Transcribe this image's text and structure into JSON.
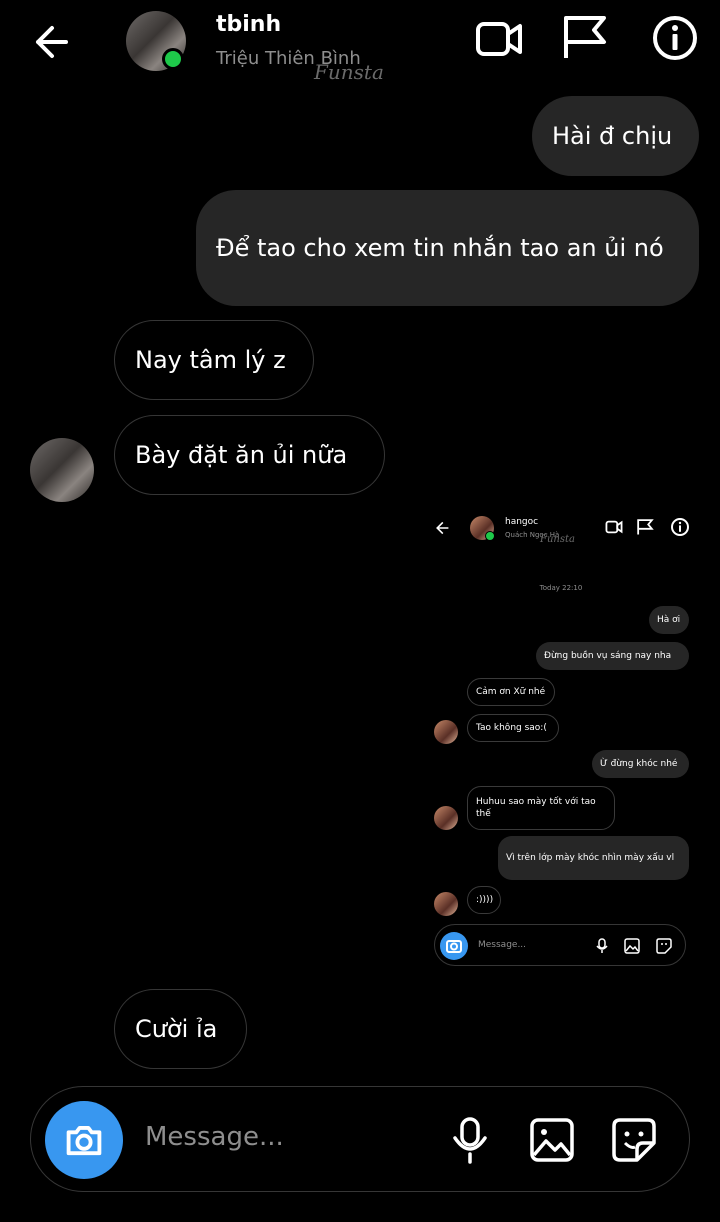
{
  "header": {
    "username": "tbinh",
    "display_name": "Triệu Thiên Bình",
    "watermark": "Funsta"
  },
  "messages": [
    {
      "from": "me",
      "text": "Hài đ chịu"
    },
    {
      "from": "me",
      "text": "Để tao cho xem tin nhắn tao an ủi nó"
    },
    {
      "from": "them",
      "text": "Nay tâm lý z"
    },
    {
      "from": "them",
      "text": "Bày đặt ăn ủi nữa"
    },
    {
      "from": "them",
      "text": "Cười ỉa"
    }
  ],
  "embedded_screenshot": {
    "username": "hangoc",
    "display_name": "Quách Ngọc Hà",
    "watermark": "Funsta",
    "timestamp": "Today 22:10",
    "messages": [
      {
        "from": "me",
        "text": "Hà ơi"
      },
      {
        "from": "me",
        "text": "Đừng buồn vụ sáng nay nha"
      },
      {
        "from": "them",
        "text": "Cảm ơn Xữ nhé"
      },
      {
        "from": "them",
        "text": "Tao không sao:("
      },
      {
        "from": "me",
        "text": "Ừ đừng khóc nhé"
      },
      {
        "from": "them",
        "text": "Huhuu sao mày tốt với tao thế"
      },
      {
        "from": "me",
        "text": "Vì trên lớp mày khóc nhìn mày xấu vl"
      },
      {
        "from": "them",
        "text": ":))))"
      }
    ],
    "composer_placeholder": "Message..."
  },
  "composer": {
    "placeholder": "Message..."
  },
  "colors": {
    "background": "#000000",
    "my_bubble": "#262626",
    "online_dot": "#1ec94a",
    "camera_button": "#3897f0"
  }
}
